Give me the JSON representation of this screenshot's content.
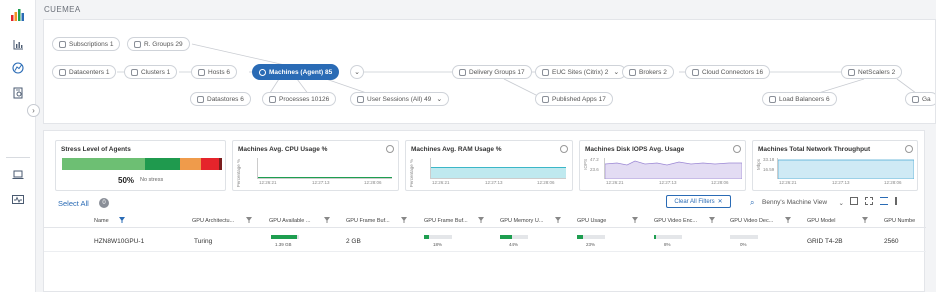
{
  "app": {
    "title": "CUEMEA"
  },
  "topology": {
    "nodes": {
      "subscriptions": "Subscriptions 1",
      "rgroups": "R. Groups 29",
      "datacenters": "Datacenters 1",
      "clusters": "Clusters 1",
      "hosts": "Hosts 6",
      "machines": "Machines (Agent) 85",
      "datastores": "Datastores 6",
      "processes": "Processes 10126",
      "user_sessions": "User Sessions (All) 49",
      "delivery_groups": "Delivery Groups 17",
      "euc_sites": "EUC Sites (Citrix) 2",
      "brokers": "Brokers 2",
      "cloud_connectors": "Cloud Connectors 16",
      "published_apps": "Published Apps 17",
      "netscalers": "NetScalers 2",
      "load_balancers": "Load Balancers 6",
      "cut_node": "Ga"
    }
  },
  "cards": {
    "stress": {
      "title": "Stress Level of Agents",
      "value": "50%",
      "label": "No stress",
      "segments": [
        {
          "pct": 52,
          "color": "#6dbf73"
        },
        {
          "pct": 22,
          "color": "#1f9a4e"
        },
        {
          "pct": 13,
          "color": "#ef9b4b"
        },
        {
          "pct": 11,
          "color": "#e5242b"
        },
        {
          "pct": 2,
          "color": "#7a1d1d"
        }
      ]
    },
    "cpu": {
      "title": "Machines Avg. CPU Usage %",
      "ylabel": "Percentage %",
      "ticks": [
        "12:26:21",
        "12:27:13",
        "12:28:06"
      ]
    },
    "ram": {
      "title": "Machines Avg. RAM Usage %",
      "ylabel": "Percentage %",
      "ticks": [
        "12:26:21",
        "12:27:13",
        "12:28:06"
      ]
    },
    "iops": {
      "title": "Machines Disk IOPS Avg. Usage",
      "ylabel": "IOPS",
      "ymax": "47.2",
      "ymid": "23.6",
      "ticks": [
        "12:26:21",
        "12:27:13",
        "12:28:06"
      ]
    },
    "net": {
      "title": "Machines Total Network Throughput",
      "ylabel": "Mbps",
      "ymax": "33.18",
      "ymid": "16.59",
      "ticks": [
        "12:26:21",
        "12:27:13",
        "12:28:06"
      ]
    }
  },
  "toolbar": {
    "select_all": "Select All",
    "select_count": "0",
    "clear_filters": "Clear All Filters",
    "view": "Benny's Machine View"
  },
  "table": {
    "headers": [
      "Name",
      "GPU Architectu...",
      "GPU Available ...",
      "GPU Frame Buf...",
      "GPU Frame Buf...",
      "GPU Memory U...",
      "GPU Usage",
      "GPU Video Enc...",
      "GPU Video Dec...",
      "GPU Model",
      "GPU Numbe"
    ],
    "row": {
      "name": "HZN8W10GPU-1",
      "arch": "Turing",
      "available": "1.39 GB",
      "available_pct": 92,
      "frame_buf": "2 GB",
      "frame_buf_pct": "18%",
      "frame_buf_val": 18,
      "mem_pct": "44%",
      "mem_val": 44,
      "usage_pct": "23%",
      "usage_val": 23,
      "enc_pct": "8%",
      "enc_val": 8,
      "dec_pct": "0%",
      "dec_val": 0,
      "model": "GRID T4-2B",
      "number": "2560"
    }
  },
  "colors": {
    "accent": "#2a6bb5",
    "good": "#1e9e50"
  }
}
